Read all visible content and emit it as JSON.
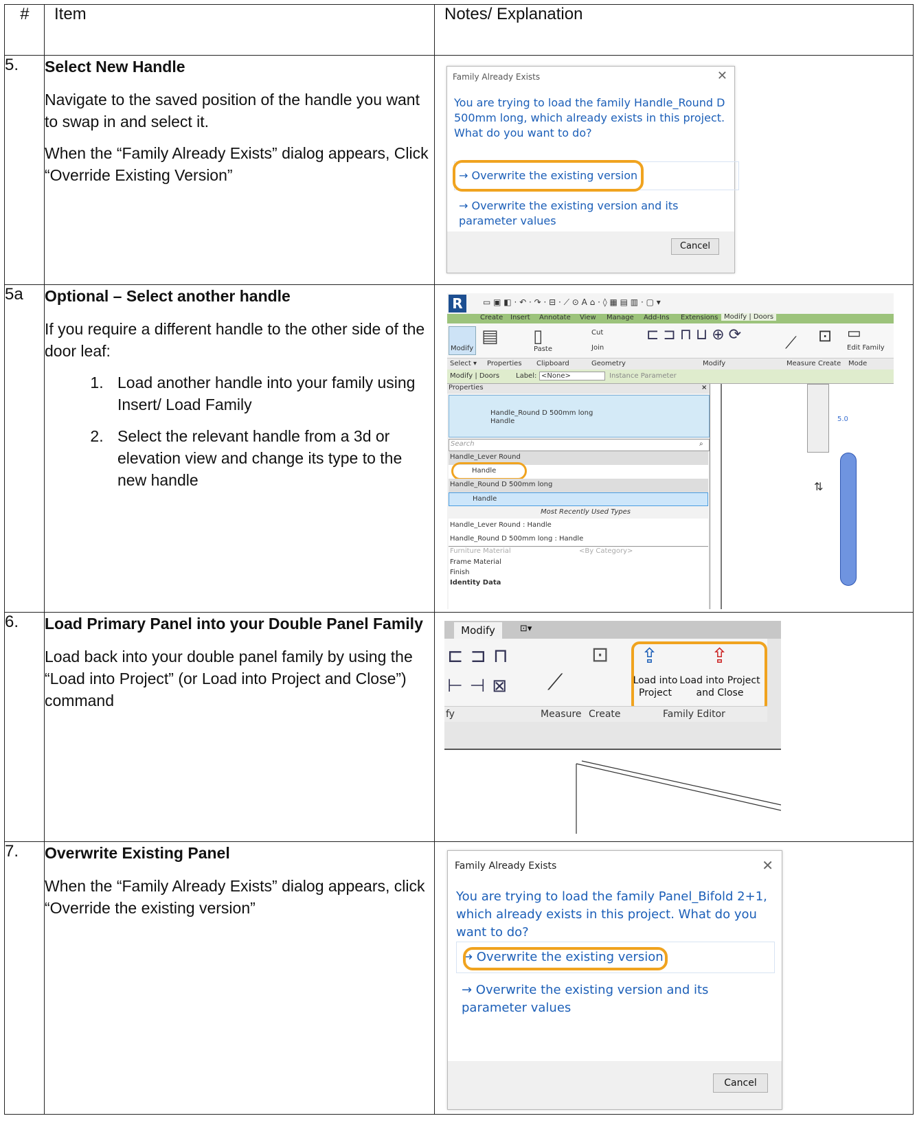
{
  "header": {
    "num": "#",
    "item": "Item",
    "notes": "Notes/ Explanation"
  },
  "rows": [
    {
      "num": "5.",
      "title": "Select New Handle",
      "paragraphs": [
        "Navigate to the saved position of the handle you want to swap in and select it.",
        "When the “Family Already Exists” dialog appears, Click “Override Existing Version”"
      ]
    },
    {
      "num": "5a",
      "title": "Optional – Select another handle",
      "paragraphs": [
        "If you require a different handle to the other side of the door leaf:"
      ],
      "list": [
        "Load another handle into your family using Insert/ Load Family",
        "Select the relevant handle from a 3d or elevation view and change its type to the new handle"
      ]
    },
    {
      "num": "6.",
      "title": "Load Primary Panel into your Double Panel Family",
      "paragraphs": [
        "Load back into your double panel family by using the “Load into Project” (or Load into Project and Close”) command"
      ]
    },
    {
      "num": "7.",
      "title": "Overwrite Existing Panel",
      "paragraphs": [
        "When the “Family Already Exists” dialog appears, click “Override the existing version”"
      ]
    }
  ],
  "dialog1": {
    "title": "Family Already Exists",
    "close": "✕",
    "question": "You are trying to load the family Handle_Round D 500mm long, which already exists in this project.  What do you want to do?",
    "option1": "→ Overwrite the existing version",
    "option2": "→ Overwrite the existing version and its parameter values",
    "cancel": "Cancel"
  },
  "revit1": {
    "tabs": [
      "Create",
      "Insert",
      "Annotate",
      "View",
      "Manage",
      "Add-Ins",
      "Extensions",
      "Modify | Doors"
    ],
    "panels": [
      "Select ▾",
      "Properties",
      "Clipboard",
      "Geometry",
      "Modify",
      "Measure",
      "Create",
      "Mode"
    ],
    "modify_label": "Modify",
    "paste_label": "Paste",
    "cut_label": "Cut",
    "join_label": "Join",
    "edit_family": "Edit Family",
    "context_bar": "Modify | Doors",
    "label_text": "Label:",
    "label_value": "<None>",
    "instance_param": "Instance Parameter",
    "properties_title": "Properties",
    "type_name": "Handle_Round D 500mm long",
    "type_sub": "Handle",
    "search_placeholder": "Search",
    "list": [
      "Handle_Lever Round",
      "Handle",
      "Handle_Round D 500mm long",
      "Handle",
      "Most Recently Used Types",
      "Handle_Lever Round : Handle",
      "Handle_Round D 500mm long : Handle"
    ],
    "props_rows": [
      "Furniture Material",
      "Frame Material",
      "Finish",
      "Identity Data"
    ],
    "by_category": "<By Category>",
    "dim_text": "5.0"
  },
  "revit2": {
    "tab": "Modify",
    "panel_modify": "fy",
    "panel_measure": "Measure",
    "panel_create": "Create",
    "panel_family_editor": "Family Editor",
    "load_into_project": "Load into Project",
    "load_into_project_close": "Load into Project and Close"
  },
  "dialog2": {
    "title": "Family Already Exists",
    "close": "✕",
    "question": "You are trying to load the family Panel_Bifold 2+1, which already exists in this project.  What do you want to do?",
    "option1": "→ Overwrite the existing version",
    "option2": "→ Overwrite the existing version and its parameter values",
    "cancel": "Cancel"
  },
  "colors": {
    "dialog_blue": "#1c5fb8",
    "highlight": "#f0a31f",
    "revit_green": "#9cc37b"
  }
}
